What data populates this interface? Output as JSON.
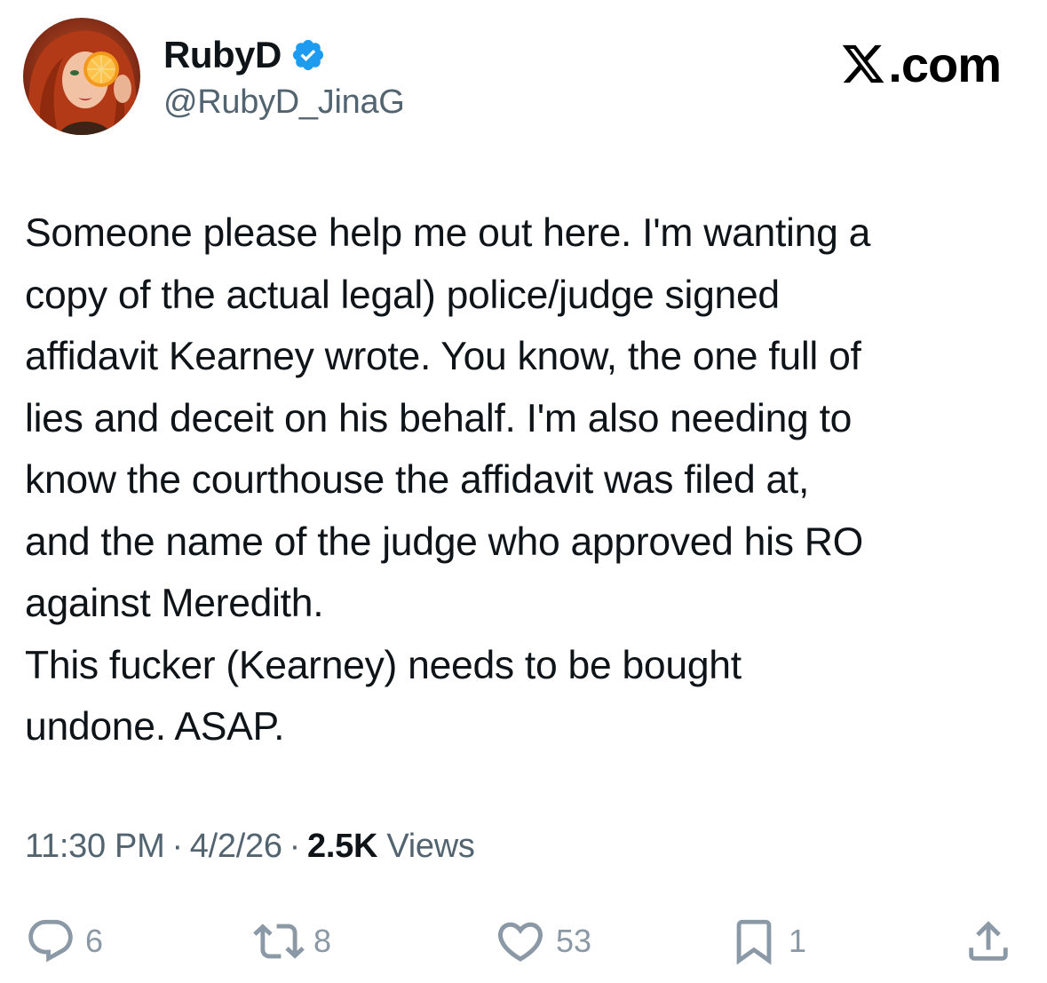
{
  "author": {
    "display_name": "RubyD",
    "handle": "@RubyD_JinaG",
    "verified": true,
    "avatar_icon": "profile-avatar"
  },
  "brand": {
    "text": "X.com",
    "icon": "x-logo-icon"
  },
  "tweet": {
    "lines": [
      "Someone please help me out here. I'm wanting a",
      "copy of the actual legal) police/judge signed",
      "affidavit Kearney wrote. You know, the one full of",
      "lies and deceit on his behalf. I'm also needing to",
      "know the courthouse the affidavit was filed at,",
      "and the name of the judge who approved his RO",
      "against Meredith.",
      "This fucker (Kearney) needs to be bought",
      "undone. ASAP."
    ]
  },
  "meta": {
    "time": "11:30 PM",
    "separator": "·",
    "date": "4/2/26",
    "views_count": "2.5K",
    "views_label": "Views"
  },
  "actions": {
    "replies": "6",
    "reposts": "8",
    "likes": "53",
    "bookmarks": "1"
  },
  "colors": {
    "text": "#0f1419",
    "secondary": "#536471",
    "icon": "#8b98a5",
    "verified": "#1d9bf0"
  }
}
